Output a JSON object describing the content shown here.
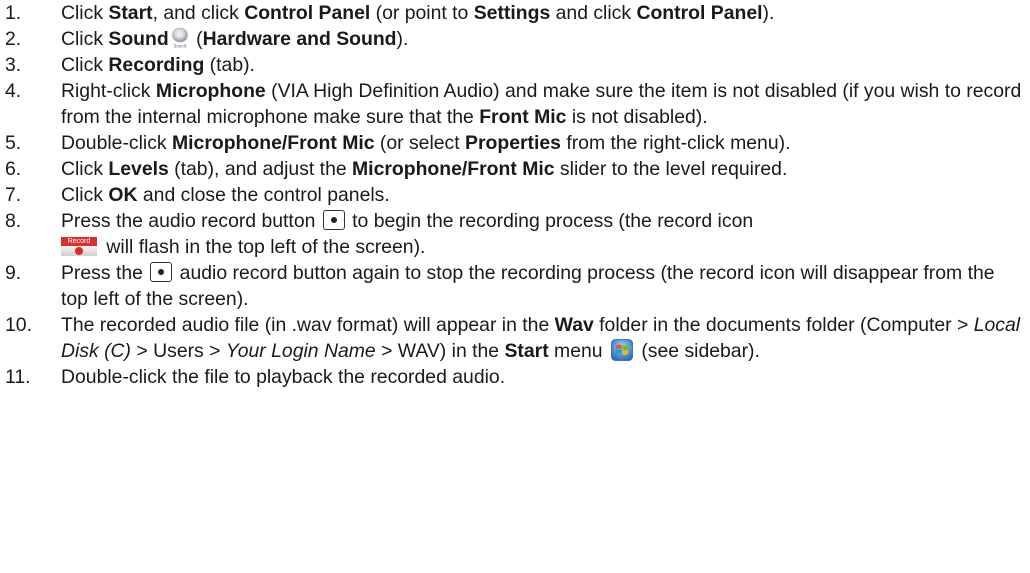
{
  "steps": [
    {
      "num": "1.",
      "p": [
        "Click ",
        "Start",
        ", and click ",
        "Control Panel",
        " (or point to ",
        "Settings",
        " and click ",
        "Control Panel",
        ")."
      ]
    },
    {
      "num": "2.",
      "p": [
        "Click ",
        "Sound",
        " (",
        "Hardware and Sound",
        ")."
      ]
    },
    {
      "num": "3.",
      "p": [
        "Click ",
        "Recording",
        " (tab)."
      ]
    },
    {
      "num": "4.",
      "p": [
        "Right-click ",
        "Microphone",
        " (VIA High Definition Audio) and make sure the item is not disabled (if you wish to record from the internal microphone make sure that the ",
        "Front Mic",
        " is not disabled)."
      ]
    },
    {
      "num": "5.",
      "p": [
        "Double-click ",
        "Microphone/Front Mic",
        " (or select ",
        "Properties",
        " from the right-click menu)."
      ]
    },
    {
      "num": "6.",
      "p": [
        "Click ",
        "Levels",
        " (tab), and adjust the ",
        "Microphone/Front Mic",
        " slider to the level required."
      ]
    },
    {
      "num": "7.",
      "p": [
        "Click ",
        "OK",
        " and close the control panels."
      ]
    },
    {
      "num": "8.",
      "p": [
        "Press the audio record button ",
        " to begin the recording process (the record icon ",
        " will flash in the top left of the screen)."
      ]
    },
    {
      "num": "9.",
      "p": [
        "Press the ",
        " audio record button again to stop the recording process (the record icon will disappear from the top left of the screen)."
      ]
    },
    {
      "num": "10.",
      "p": [
        "The recorded audio file (in .wav format) will appear in the ",
        "Wav",
        " folder in the documents folder (Computer > ",
        "Local Disk (C)",
        " > Users > ",
        "Your Login Name",
        " > WAV) in the ",
        "Start",
        " menu ",
        " (see sidebar)."
      ]
    },
    {
      "num": "11.",
      "p": [
        "Double-click the file to playback the recorded audio."
      ]
    }
  ],
  "icons": {
    "sound_icon_caption": "Sound",
    "record_icon_label": "Record"
  }
}
